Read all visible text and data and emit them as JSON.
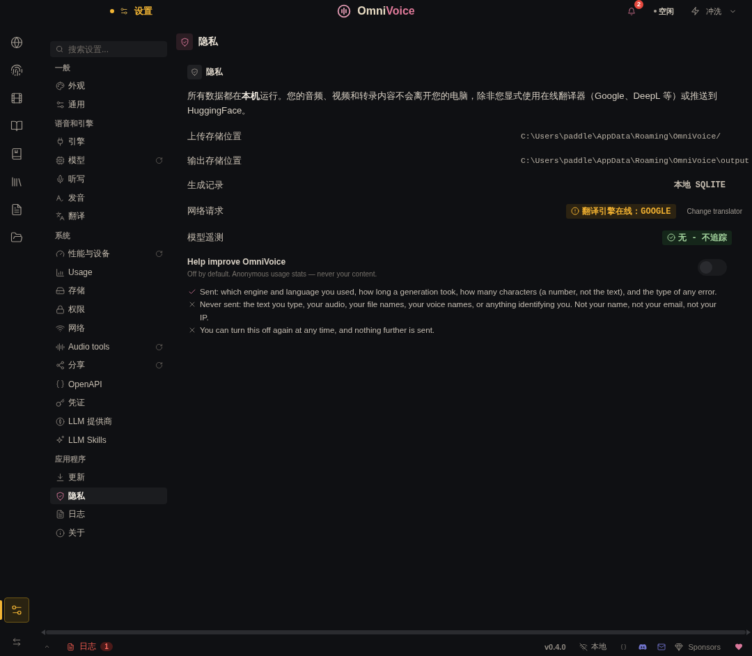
{
  "top_bar": {
    "page_title": "设置",
    "app_name": [
      "Omni",
      "Voice"
    ],
    "notification_count": "2",
    "status": "空闲",
    "action": "冲洗"
  },
  "nav_rail": [
    {
      "kind": "main",
      "selected": false
    },
    {
      "kind": "main",
      "selected": false
    },
    {
      "kind": "main",
      "selected": false
    },
    {
      "kind": "main",
      "selected": false
    },
    {
      "kind": "main",
      "selected": false
    },
    {
      "kind": "main",
      "selected": false
    },
    {
      "kind": "main",
      "selected": false
    },
    {
      "kind": "main",
      "selected": false
    },
    {
      "kind": "pinned",
      "selected": true
    }
  ],
  "sidebar": {
    "search": {
      "placeholder": "搜索设置..."
    },
    "groups": [
      {
        "title": "一般",
        "items": [
          {
            "label": "外观",
            "selected": false,
            "refresh": false
          },
          {
            "label": "通用",
            "selected": false,
            "refresh": false
          }
        ]
      },
      {
        "title": "语音和引擎",
        "items": [
          {
            "label": "引擎",
            "selected": false,
            "refresh": false
          },
          {
            "label": "模型",
            "selected": false,
            "refresh": true
          },
          {
            "label": "听写",
            "selected": false,
            "refresh": false
          },
          {
            "label": "发音",
            "selected": false,
            "refresh": false
          },
          {
            "label": "翻译",
            "selected": false,
            "refresh": false
          }
        ]
      },
      {
        "title": "系统",
        "items": [
          {
            "label": "性能与设备",
            "selected": false,
            "refresh": true
          },
          {
            "label": "Usage",
            "selected": false,
            "refresh": false
          },
          {
            "label": "存储",
            "selected": false,
            "refresh": false
          },
          {
            "label": "权限",
            "selected": false,
            "refresh": false
          },
          {
            "label": "网络",
            "selected": false,
            "refresh": false
          },
          {
            "label": "Audio tools",
            "selected": false,
            "refresh": true
          },
          {
            "label": "分享",
            "selected": false,
            "refresh": true
          },
          {
            "label": "OpenAPI",
            "selected": false,
            "refresh": false
          },
          {
            "label": "凭证",
            "selected": false,
            "refresh": false
          },
          {
            "label": "LLM 提供商",
            "selected": false,
            "refresh": false
          },
          {
            "label": "LLM Skills",
            "selected": false,
            "refresh": false
          }
        ]
      },
      {
        "title": "应用程序",
        "items": [
          {
            "label": "更新",
            "selected": false,
            "refresh": false
          },
          {
            "label": "隐私",
            "selected": true,
            "refresh": false
          },
          {
            "label": "日志",
            "selected": false,
            "refresh": false
          },
          {
            "label": "关于",
            "selected": false,
            "refresh": false
          }
        ]
      }
    ]
  },
  "content": {
    "title": "隐私",
    "card": {
      "title": "隐私",
      "description": "所有数据都在**本机**运行。您的音频、视频和转录内容不会离开您的电脑，除非您显式使用在线翻译器（Google、DeepL 等）或推送到HuggingFace。",
      "rows": [
        {
          "kind": "path",
          "label": "上传存储位置",
          "value": "C:\\Users\\paddle\\AppData\\Roaming\\OmniVoice/"
        },
        {
          "kind": "path",
          "label": "输出存储位置",
          "value": "C:\\Users\\paddle\\AppData\\Roaming\\OmniVoice\\output"
        },
        {
          "kind": "plain",
          "label": "生成记录",
          "value": "本地 SQLITE"
        },
        {
          "kind": "warning",
          "label": "网络请求",
          "value": "翻译引擎在线：GOOGLE",
          "link": "Change translator"
        },
        {
          "kind": "ok",
          "label": "模型遥测",
          "value": "无 - 不追踪"
        }
      ],
      "telemetry": {
        "title": "Help improve OmniVoice",
        "subtitle": "Off by default. Anonymous usage stats — never your content.",
        "on": false,
        "points": [
          {
            "kind": "sent",
            "text": "Sent: which engine and language you used, how long a generation took, how many characters (a number, not the text), and the type of any error."
          },
          {
            "kind": "never",
            "text": "Never sent: the text you type, your audio, your file names, your voice names, or anything identifying you. Not your name, not your email, not your IP."
          },
          {
            "kind": "never",
            "text": "You can turn this off again at any time, and nothing further is sent."
          }
        ]
      }
    }
  },
  "status_bar": {
    "log_label": "日志",
    "log_count": "1",
    "version": "v0.4.0",
    "connection": "本地",
    "sponsors": "Sponsors"
  }
}
